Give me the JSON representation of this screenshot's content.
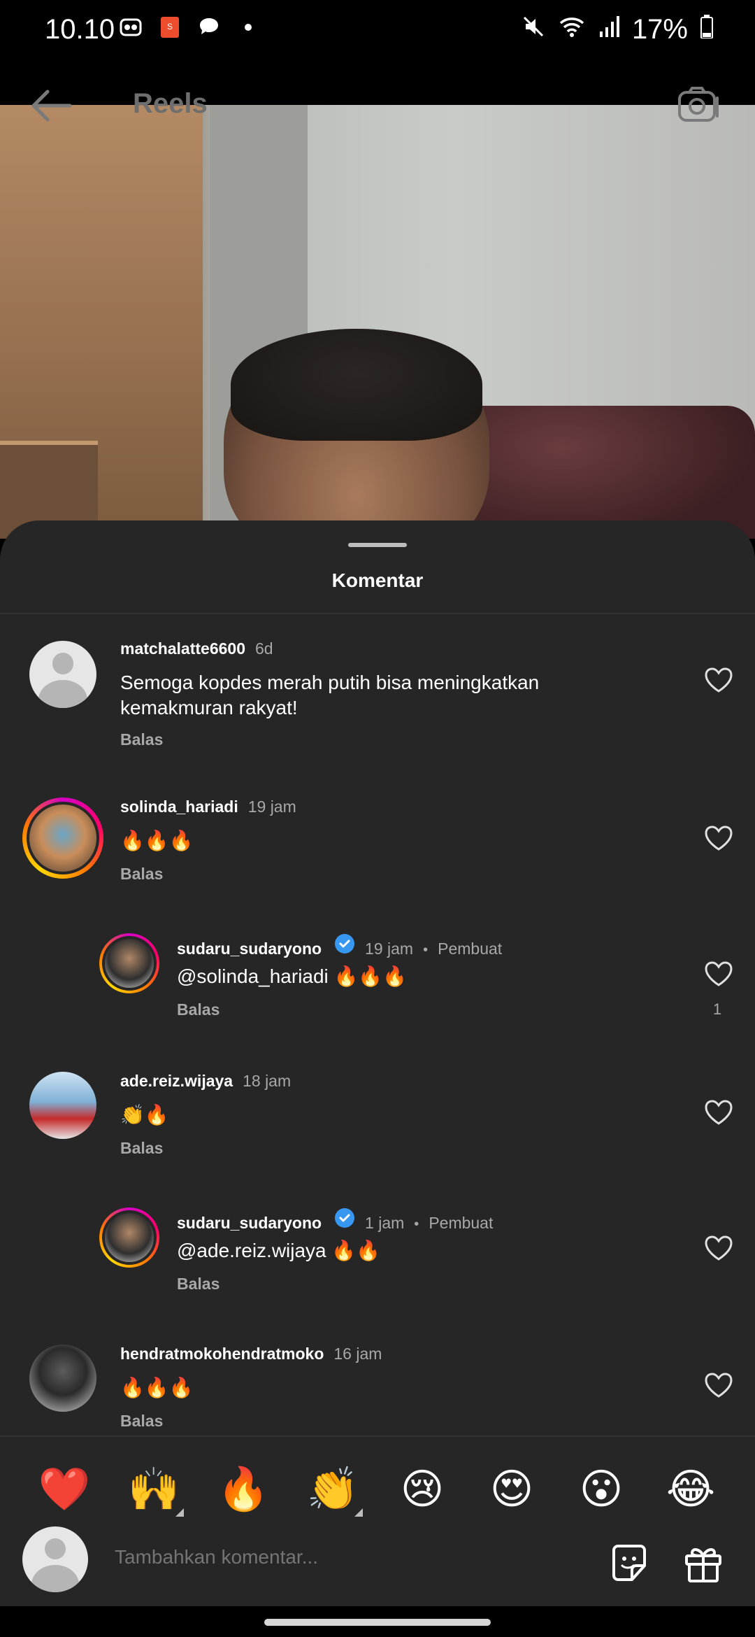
{
  "status_bar": {
    "time": "10.10",
    "battery": "17%"
  },
  "header": {
    "title": "Reels"
  },
  "sheet": {
    "title": "Komentar"
  },
  "comments": [
    {
      "username": "matchalatte6600",
      "time": "6d",
      "text": "Semoga kopdes merah putih bisa meningkatkan kemakmuran rakyat!",
      "reply": "Balas"
    },
    {
      "username": "solinda_hariadi",
      "time": "19 jam",
      "text": "🔥🔥🔥",
      "reply": "Balas"
    },
    {
      "username": "sudaru_sudaryono",
      "time": "19 jam",
      "creator": "Pembuat",
      "text": "@solinda_hariadi 🔥🔥🔥",
      "reply": "Balas",
      "likes": "1"
    },
    {
      "username": "ade.reiz.wijaya",
      "time": "18 jam",
      "text": "👏🔥",
      "reply": "Balas"
    },
    {
      "username": "sudaru_sudaryono",
      "time": "1 jam",
      "creator": "Pembuat",
      "text": "@ade.reiz.wijaya 🔥🔥",
      "reply": "Balas"
    },
    {
      "username": "hendratmokohendratmoko",
      "time": "16 jam",
      "text": "🔥🔥🔥",
      "reply": "Balas"
    }
  ],
  "emoji_bar": [
    "❤️",
    "🙌",
    "🔥",
    "👏",
    "😢",
    "😍",
    "😮",
    "😂"
  ],
  "composer": {
    "placeholder": "Tambahkan komentar..."
  },
  "icons": [
    "back-arrow-icon",
    "camera-icon",
    "heart-icon",
    "verified-badge-icon",
    "sticker-icon",
    "gift-icon"
  ]
}
